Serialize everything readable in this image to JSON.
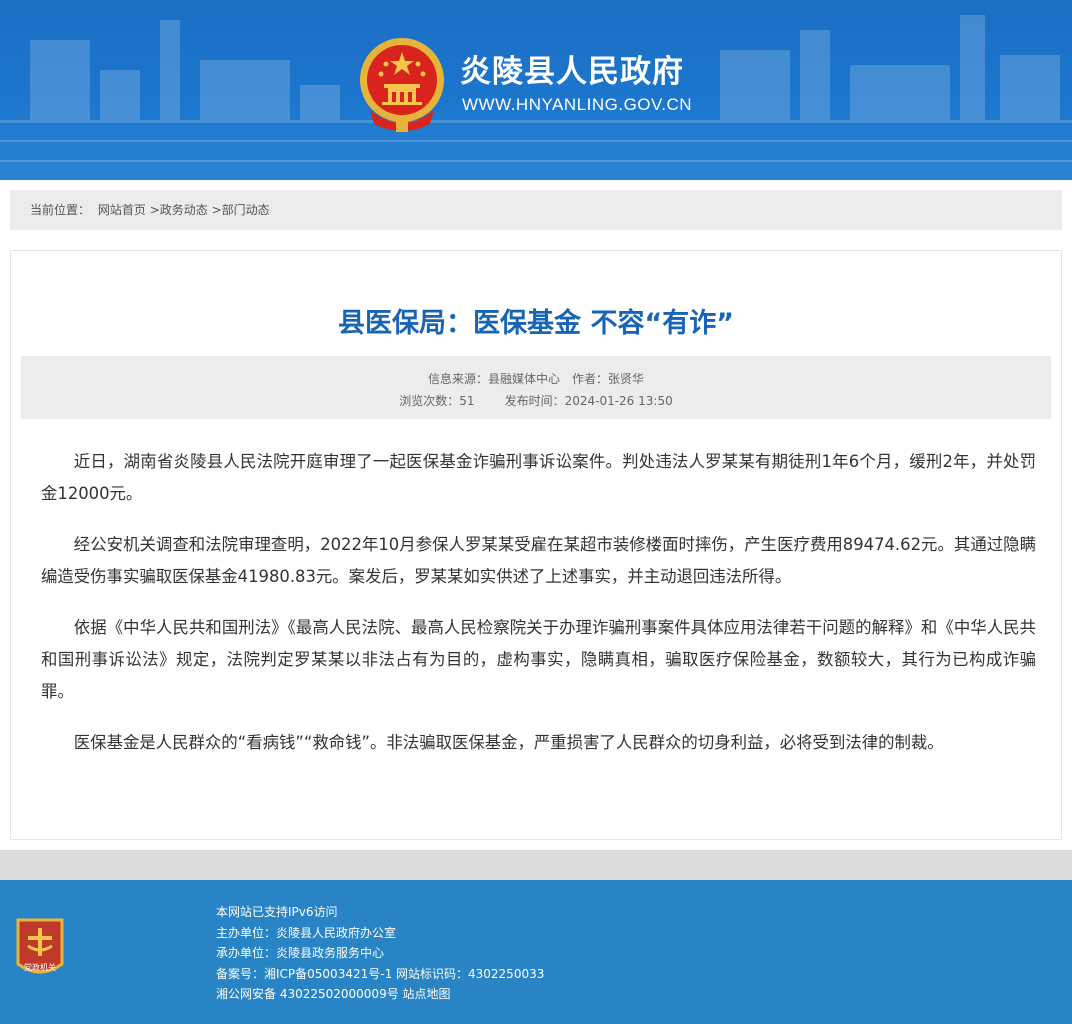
{
  "header": {
    "title": "炎陵县人民政府",
    "url": "WWW.HNYANLING.GOV.CN"
  },
  "breadcrumb": {
    "label": "当前位置：",
    "items": [
      "网站首页",
      ">政务动态",
      ">部门动态"
    ]
  },
  "article": {
    "title": "县医保局：医保基金 不容“有诈”",
    "meta": {
      "source_label": "信息来源：",
      "source": "县融媒体中心",
      "author_label": "作者：",
      "author": "张贤华",
      "views_label": "浏览次数：",
      "views": "51",
      "date_label": "发布时间：",
      "date": "2024-01-26 13:50"
    },
    "paragraphs": [
      "近日，湖南省炎陵县人民法院开庭审理了一起医保基金诈骗刑事诉讼案件。判处违法人罗某某有期徒刑1年6个月，缓刑2年，并处罚金12000元。",
      "经公安机关调查和法院审理查明，2022年10月参保人罗某某受雇在某超市装修楼面时摔伤，产生医疗费用89474.62元。其通过隐瞒编造受伤事实骗取医保基金41980.83元。案发后，罗某某如实供述了上述事实，并主动退回违法所得。",
      "依据《中华人民共和国刑法》《最高人民法院、最高人民检察院关于办理诈骗刑事案件具体应用法律若干问题的解释》和《中华人民共和国刑事诉讼法》规定，法院判定罗某某以非法占有为目的，虚构事实，隐瞒真相，骗取医疗保险基金，数额较大，其行为已构成诈骗罪。",
      "医保基金是人民群众的“看病钱”“救命钱”。非法骗取医保基金，严重损害了人民群众的切身利益，必将受到法律的制裁。"
    ]
  },
  "footer": {
    "badge_text": "党政机关",
    "lines": [
      "本网站已支持IPv6访问",
      "主办单位：炎陵县人民政府办公室",
      "承办单位：炎陵县政务服务中心",
      "备案号：湘ICP备05003421号-1 网站标识码：4302250033",
      "湘公网安备 43022502000009号 站点地图"
    ]
  },
  "colors": {
    "header_blue": "#1c76cd",
    "title_blue": "#1864b5",
    "footer_blue": "#2884c4",
    "emblem_red": "#d8241c",
    "emblem_gold": "#e7b43a"
  }
}
